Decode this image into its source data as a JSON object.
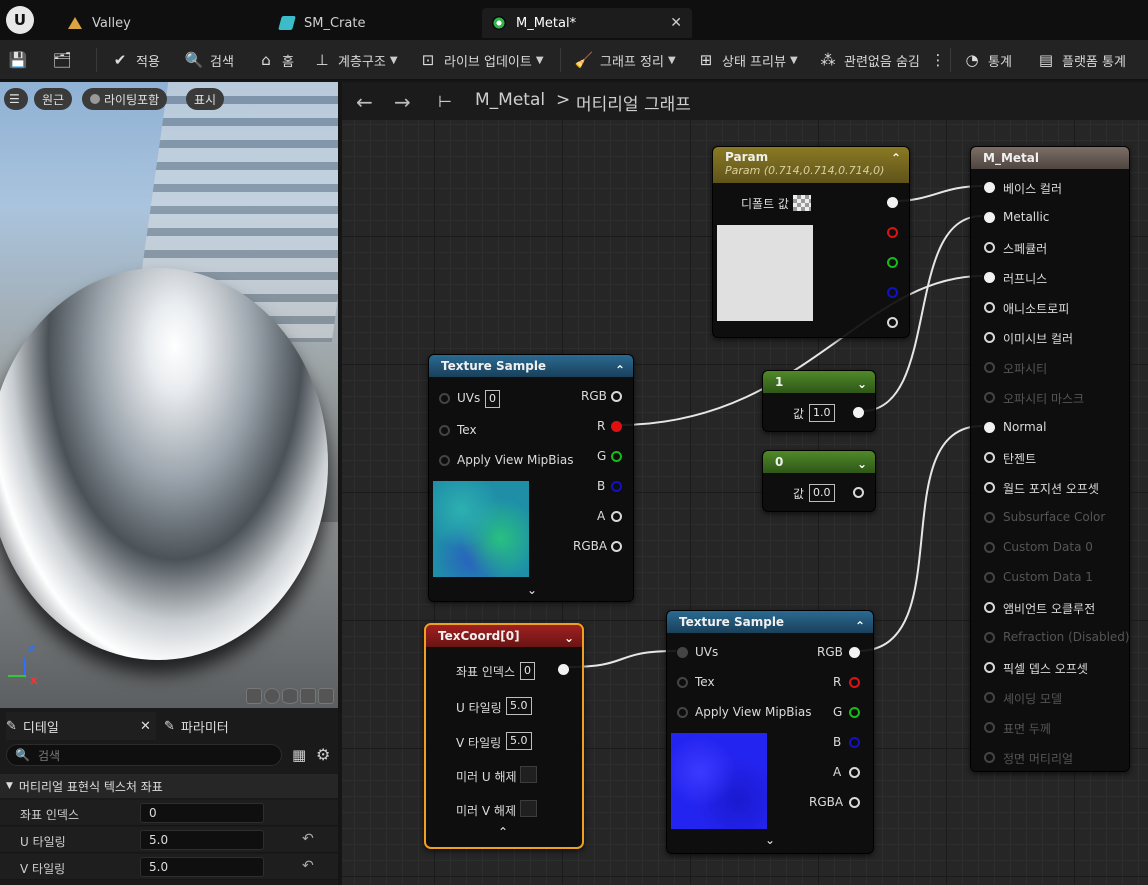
{
  "tabs": [
    {
      "label": "Valley",
      "icon": "level-icon"
    },
    {
      "label": "SM_Crate",
      "icon": "static-mesh-icon"
    },
    {
      "label": "M_Metal*",
      "icon": "material-icon"
    }
  ],
  "toolbar": {
    "apply": "적용",
    "search": "검색",
    "home": "홈",
    "hierarchy": "계층구조",
    "live_update": "라이브 업데이트",
    "clean_graph": "그래프 정리",
    "state_preview": "상태 프리뷰",
    "hide_unrelated": "관련없음 숨김",
    "stats": "통계",
    "platform_stats": "플랫폼 통계"
  },
  "viewport": {
    "perspective": "원근",
    "lighting": "라이팅포함",
    "show": "표시",
    "axis_z": "Z",
    "axis_x": "X"
  },
  "details": {
    "tab_details": "디테일",
    "tab_params": "파라미터",
    "search_placeholder": "검색",
    "section": "머티리얼 표현식 텍스처 좌표",
    "rows": [
      {
        "label": "좌표 인덱스",
        "value": "0"
      },
      {
        "label": "U 타일링",
        "value": "5.0"
      },
      {
        "label": "V 타일링",
        "value": "5.0"
      }
    ]
  },
  "graph": {
    "breadcrumb_material": "M_Metal",
    "breadcrumb_sep": ">",
    "breadcrumb_graph": "머티리얼 그래프",
    "param_node": {
      "title": "Param",
      "subtitle": "Param (0.714,0.714,0.714,0)",
      "default_label": "디폴트 값"
    },
    "tex_sample_1": {
      "title": "Texture Sample",
      "uvs": "UVs",
      "uvs_val": "0",
      "tex": "Tex",
      "mip": "Apply View MipBias",
      "out_rgb": "RGB",
      "out_r": "R",
      "out_g": "G",
      "out_b": "B",
      "out_a": "A",
      "out_rgba": "RGBA"
    },
    "const_1": {
      "title": "1",
      "label": "값",
      "value": "1.0"
    },
    "const_0": {
      "title": "0",
      "label": "값",
      "value": "0.0"
    },
    "texcoord": {
      "title": "TexCoord[0]",
      "coord_index": "좌표 인덱스",
      "coord_val": "0",
      "u_tiling": "U 타일링",
      "u_val": "5.0",
      "v_tiling": "V 타일링",
      "v_val": "5.0",
      "mirror_u": "미러 U 해제",
      "mirror_v": "미러 V 해제"
    },
    "tex_sample_2": {
      "title": "Texture Sample",
      "uvs": "UVs",
      "tex": "Tex",
      "mip": "Apply View MipBias",
      "out_rgb": "RGB",
      "out_r": "R",
      "out_g": "G",
      "out_b": "B",
      "out_a": "A",
      "out_rgba": "RGBA"
    },
    "material": {
      "title": "M_Metal",
      "inputs": [
        {
          "label": "베이스 컬러",
          "state": "connected"
        },
        {
          "label": "Metallic",
          "state": "connected"
        },
        {
          "label": "스페큘러",
          "state": "active"
        },
        {
          "label": "러프니스",
          "state": "connected"
        },
        {
          "label": "애니소트로피",
          "state": "active"
        },
        {
          "label": "이미시브 컬러",
          "state": "active"
        },
        {
          "label": "오파시티",
          "state": "disabled"
        },
        {
          "label": "오파시티 마스크",
          "state": "disabled"
        },
        {
          "label": "Normal",
          "state": "connected"
        },
        {
          "label": "탄젠트",
          "state": "active"
        },
        {
          "label": "월드 포지션 오프셋",
          "state": "active"
        },
        {
          "label": "Subsurface Color",
          "state": "disabled"
        },
        {
          "label": "Custom Data 0",
          "state": "disabled"
        },
        {
          "label": "Custom Data 1",
          "state": "disabled"
        },
        {
          "label": "앰비언트 오클루전",
          "state": "active"
        },
        {
          "label": "Refraction (Disabled)",
          "state": "disabled"
        },
        {
          "label": "픽셀 뎁스 오프셋",
          "state": "active"
        },
        {
          "label": "셰이딩 모델",
          "state": "disabled"
        },
        {
          "label": "표면 두께",
          "state": "disabled"
        },
        {
          "label": "정면 머티리얼",
          "state": "disabled"
        }
      ]
    }
  },
  "colors": {
    "param_header": "#7a6a1e",
    "texsample_header": "#1d4c6a",
    "constant_header": "#3f6a1c",
    "texcoord_header": "#8a1a1a",
    "material_header": "#6a5d55",
    "selection": "#f0a020",
    "pin_red": "#e01010",
    "pin_green": "#10c010",
    "pin_blue": "#1010d0"
  }
}
